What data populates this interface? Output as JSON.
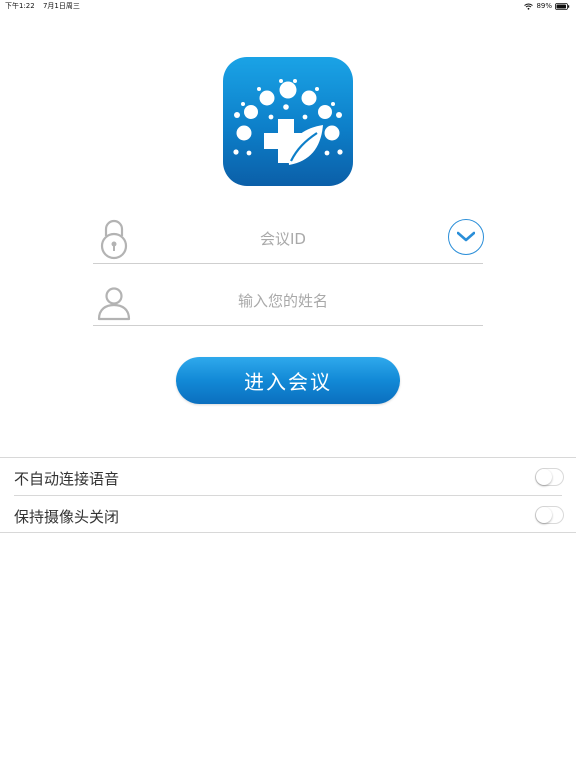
{
  "status_bar": {
    "time": "下午1:22",
    "date": "7月1日周三",
    "battery": "89%",
    "wifi_icon": "wifi-icon",
    "battery_icon": "battery-icon"
  },
  "app_icon": "app-logo-icon",
  "form": {
    "meeting_id": {
      "value": "",
      "placeholder": "会议ID",
      "icon": "lock-icon",
      "dropdown_icon": "chevron-down-icon"
    },
    "name": {
      "value": "",
      "placeholder": "输入您的姓名",
      "icon": "user-icon"
    },
    "join_label": "进入会议"
  },
  "settings": [
    {
      "label": "不自动连接语音",
      "on": false
    },
    {
      "label": "保持摄像头关闭",
      "on": false
    }
  ],
  "colors": {
    "accent": "#1289d6",
    "brand_dark": "#0b5fa8"
  }
}
